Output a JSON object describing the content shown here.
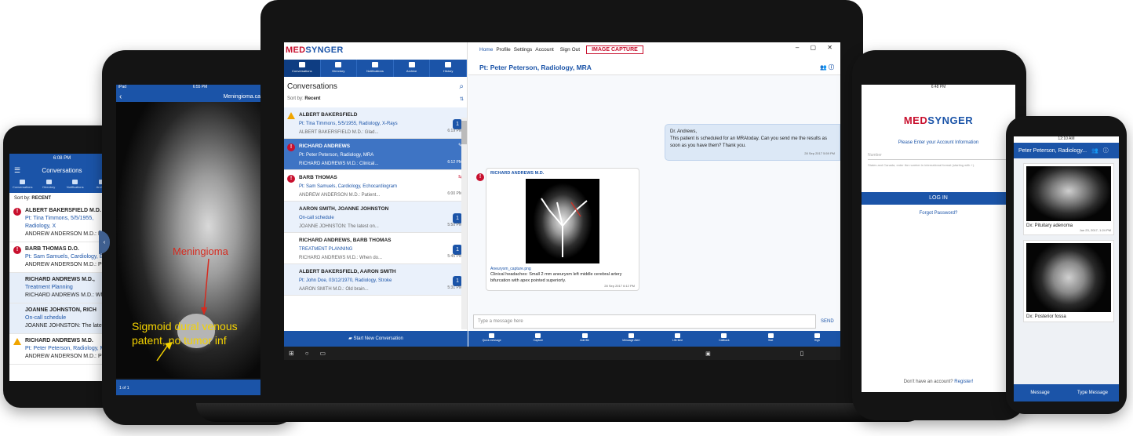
{
  "brand": {
    "logo_red": "MED",
    "logo_blue": "SYNGER",
    "accent": "#1b54a8",
    "alert": "#c8102e"
  },
  "phone_left": {
    "status_time": "6:08 PM",
    "title": "Conversations",
    "tabs": [
      "Conversations",
      "Directory",
      "Notifications",
      "Archive"
    ],
    "sort_label": "Sort by:",
    "sort_value": "RECENT",
    "items": [
      {
        "name": "ALBERT BAKERSFIELD M.D.",
        "patient": "Pt: Tina Timmons, 5/5/1955, Radiology, X",
        "preview": "ANDREW ANDERSON M.D.: Pa"
      },
      {
        "name": "BARB THOMAS D.O.",
        "patient": "Pt: Sam Samuels, Cardiology, E",
        "preview": "ANDREW ANDERSON M.D.: Pa"
      },
      {
        "name": "RICHARD ANDREWS M.D., ",
        "patient": "Treatment Planning",
        "preview": "RICHARD ANDREWS M.D.: Whe"
      },
      {
        "name": "JOANNE JOHNSTON, RICH",
        "patient": "On-call schedule",
        "preview": "JOANNE JOHNSTON: The lates"
      },
      {
        "name": "RICHARD ANDREWS M.D.",
        "patient": "Pt: Peter Peterson, Radiology, M",
        "preview": "ANDREW ANDERSON M.D.: Ple"
      }
    ]
  },
  "tablet_left": {
    "status_left": "iPad",
    "status_time": "6:55 PM",
    "title": "Meningioma.capture",
    "label_top": "Meningioma",
    "label_bottom": "Sigmoid dural venous patent, no tumor inf",
    "page": "1 of 1"
  },
  "laptop": {
    "left_tabs": [
      "Conversations",
      "Directory",
      "Notifications",
      "Archive",
      "History"
    ],
    "conversations_title": "Conversations",
    "sort_label": "Sort by:",
    "sort_value": "Recent",
    "items": [
      {
        "name": "ALBERT BAKERSFIELD",
        "patient": "Pt: Tina Timmons, 5/5/1955, Radiology, X-Rays",
        "preview": "ALBERT BAKERSFIELD M.D.: Glad...",
        "time": "6:19 PM",
        "badge": "1"
      },
      {
        "name": "RICHARD ANDREWS",
        "patient": "Pt: Peter Peterson, Radiology, MRA",
        "preview": "RICHARD ANDREWS M.D.: Clinical...",
        "time": "6:12 PM",
        "badge": "1"
      },
      {
        "name": "BARB THOMAS",
        "patient": "Pt: Sam Samuels, Cardiology, Echocardiogram",
        "preview": "ANDREW ANDERSON M.D.: Patient...",
        "time": "6:00 PM",
        "badge": ""
      },
      {
        "name": "AARON SMITH, JOANNE JOHNSTON",
        "patient": "On-call schedule",
        "preview": "JOANNE JOHNSTON: The latest on...",
        "time": "5:50 PM",
        "badge": "1"
      },
      {
        "name": "RICHARD ANDREWS, BARB THOMAS",
        "patient": "TREATMENT PLANNING",
        "preview": "RICHARD ANDREWS M.D.: When do...",
        "time": "5:45 PM",
        "badge": "1"
      },
      {
        "name": "ALBERT BAKERSFIELD, AARON SMITH",
        "patient": "Pt: John Doe, 03/12/1970, Radiology, Stroke",
        "preview": "AARON SMITH M.D.: Old brain...",
        "time": "5:31 PM",
        "badge": "1"
      }
    ],
    "start_button": "Start New Conversation",
    "nav": [
      "Home",
      "Profile",
      "Settings",
      "Account",
      "Sign Out"
    ],
    "capture_label": "IMAGE CAPTURE",
    "patient_header": "Pt: Peter Peterson, Radiology, MRA",
    "msg_out": {
      "text": "Dr. Andrews,\nThis patient is scheduled for an MRAtoday. Can you send me the results as soon as you have them?  Thank you.",
      "time": "28 Sep 2017 5:59 PM"
    },
    "msg_in": {
      "from": "RICHARD ANDREWS M.D.",
      "file": "Aneurysm_capture.png",
      "text": "Clinical headaches: Small 2 mm aneurysm left middle cerebral artery bifurcation with apex pointed superiorly.",
      "time": "28 Sep 2017 6:12 PM"
    },
    "input_placeholder": "Type a message here",
    "send_label": "SEND",
    "tools": [
      "Quick message",
      "Capture",
      "Add file",
      "Message Alert",
      "Life time",
      "Callback",
      "Stat",
      "High"
    ]
  },
  "tablet_right": {
    "status_time": "6:48 PM",
    "prompt": "Please Enter your Account Information",
    "field_label": "Number",
    "hint": "States and Canada, enter the number in international format (starting with +).",
    "login": "LOG IN",
    "forgot": "Forgot Password?",
    "no_account": "Don't have an account?",
    "register": "Register!"
  },
  "phone_right": {
    "status_time": "12:10 AM",
    "title": "Peter Peterson, Radiology...",
    "card1_caption": "Dx: Pituitary adenoma",
    "card1_time": "Jun 23, 2017, 1:24 PM",
    "card2_caption": "Dx: Posterior fossa",
    "bottom": [
      "Message",
      "Type Message"
    ]
  }
}
